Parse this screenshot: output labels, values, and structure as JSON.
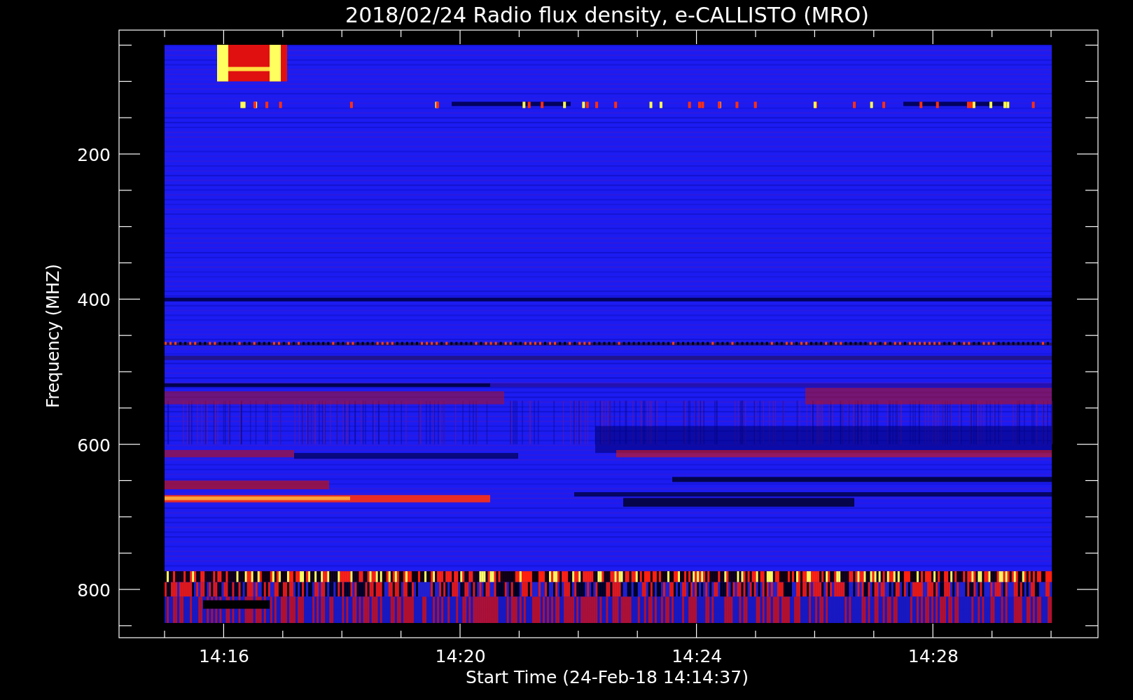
{
  "title": "2018/02/24  Radio flux density, e-CALLISTO (MRO)",
  "y_axis": {
    "label": "Frequency (MHZ)",
    "ticks": [
      "200",
      "400",
      "600",
      "800"
    ]
  },
  "x_axis": {
    "label": "Start Time (24-Feb-18 14:14:37)",
    "ticks": [
      "14:16",
      "14:20",
      "14:24",
      "14:28"
    ]
  }
}
